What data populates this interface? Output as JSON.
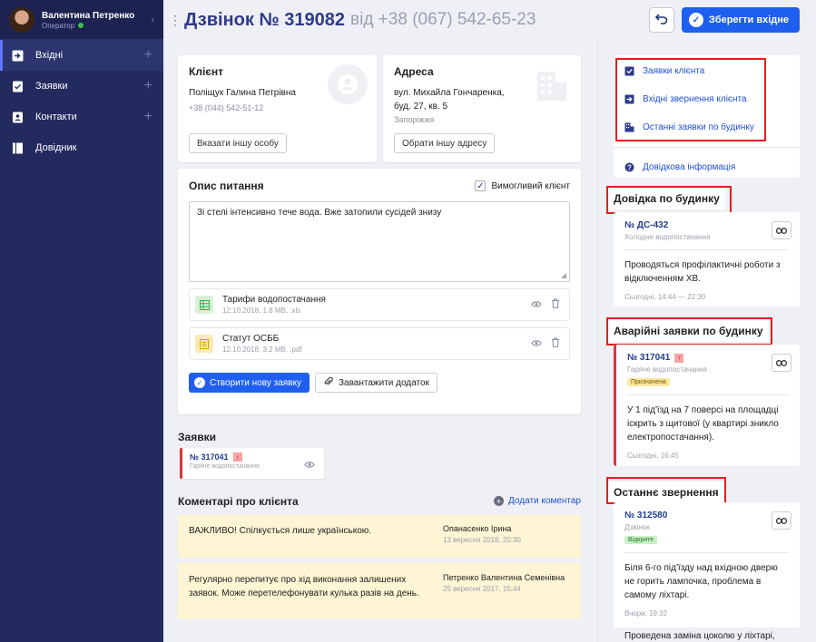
{
  "user": {
    "name": "Валентина Петренко",
    "role": "Оператор"
  },
  "sidebar": {
    "items": [
      {
        "label": "Вхідні",
        "plus": "+"
      },
      {
        "label": "Заявки",
        "plus": "+"
      },
      {
        "label": "Контакти",
        "plus": "+"
      },
      {
        "label": "Довідник",
        "plus": ""
      }
    ]
  },
  "header": {
    "title": "Дзвінок № 319082",
    "subtitle": "від +38 (067) 542-65-23",
    "save_label": "Зберегти вхідне"
  },
  "client": {
    "heading": "Клієнт",
    "name": "Поліщук Галина Петрівна",
    "phone": "+38 (044) 542-51-12",
    "button": "Вказати іншу особу"
  },
  "address": {
    "heading": "Адреса",
    "street": "вул. Михайла Гончаренка,",
    "building": "буд. 27, кв. 5",
    "city": "Запоріжжя",
    "button": "Обрати іншу адресу"
  },
  "description": {
    "heading": "Опис питання",
    "vip_label": "Вимогливий клієнт",
    "vip_checked": "✓",
    "text": "Зі стелі інтенсивно тече вода. Вже затопили сусідей знизу",
    "files": [
      {
        "name": "Тарифи водопостачання",
        "meta": "12.10.2018, 1.8 MB, .xls",
        "icon": "spreadsheet-icon",
        "color": "#3aa84a"
      },
      {
        "name": "Статут ОСББ",
        "meta": "12.10.2018, 3.2 MB, .pdf",
        "icon": "document-icon",
        "color": "#d9a300"
      }
    ],
    "create_btn": "Створити нову заявку",
    "upload_btn": "Завантажити додаток"
  },
  "requests": {
    "heading": "Заявки",
    "items": [
      {
        "number": "№ 317041",
        "type": "Гаряче водопостачання"
      }
    ]
  },
  "comments": {
    "heading": "Коментарі про клієнта",
    "add_label": "Додати коментар",
    "items": [
      {
        "text": "ВАЖЛИВО! Спілкується лише українською.",
        "author": "Опанасенко Ірина",
        "date": "13 вересня 2018, 20:30"
      },
      {
        "text": "Регулярно перепитує про хід виконання залишених заявок. Може перетелефонувати кулька разів на день.",
        "author": "Петренко Валентина Семенівна",
        "date": "25 вересня 2017, 15:44"
      }
    ]
  },
  "right": {
    "links": [
      "Заявки клієнта",
      "Вхідні звернення клієнта",
      "Останні заявки по будинку"
    ],
    "help_link": "Довідкова інформація",
    "building_ref": {
      "heading": "Довідка по будинку",
      "number": "№ ДС-432",
      "type": "Холодне водопостачання",
      "text": "Проводяться профілактичні роботи з відключенням ХВ.",
      "time": "Сьогодні, 14:44 — 22:30"
    },
    "emergency": {
      "heading": "Аварійні заявки по будинку",
      "number": "№ 317041",
      "type": "Гаряче водопостачання",
      "status": "Призначена",
      "text": "У 1 під'їзд на 7 поверсі на площадці іскрить з щитової (у квартирі зникло електропостачання).",
      "time": "Сьогодні, 16:45"
    },
    "last_contact": {
      "heading": "Останнє звернення",
      "number": "№ 312580",
      "type": "Дзвінок",
      "status": "Відкрите",
      "text": "Біля 6-го під'їзду над вхідною дверю не горить лампочка, проблема в самому ліхтарі.",
      "time": "Вчора, 19:32",
      "more": "Проведена заміна цоколю у ліхтарі,"
    }
  },
  "colors": {
    "accent": "#1f5ff0",
    "sidebar": "#222a5e",
    "highlight": "#e02020"
  }
}
